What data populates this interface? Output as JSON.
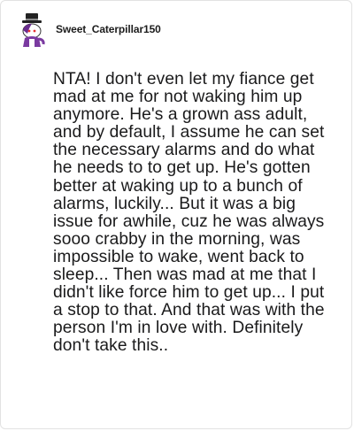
{
  "comment": {
    "author": {
      "username": "Sweet_Caterpillar150",
      "avatar_icon": "snoo-avatar-icon"
    },
    "body": "NTA! I don't even let my fiance get mad at me for not waking him up anymore. He's a grown ass adult, and by default, I assume he can set the necessary alarms and do what he needs to to get up. He's gotten better at waking up to a bunch of alarms, luckily... But it was a big issue for awhile, cuz he was always sooo crabby in the morning, was impossible to wake, went back to sleep... Then was mad at me that I didn't like force him to get up... I put a stop to that. And that was with the person I'm in love with. Definitely don't take this.."
  },
  "colors": {
    "card_border": "#e2e2e2",
    "text": "#1a1a1b",
    "avatar_purple": "#6a2c8f",
    "avatar_hat": "#222222"
  }
}
